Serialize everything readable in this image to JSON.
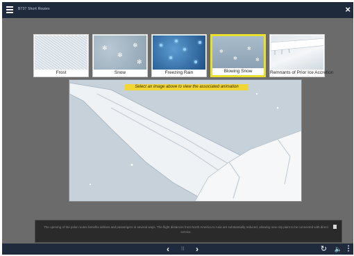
{
  "header": {
    "title": "B737 Short Routes",
    "menu_icon": "hamburger-menu-icon",
    "close_icon": "close-icon"
  },
  "thumbnails": [
    {
      "label": "Frost",
      "selected": false
    },
    {
      "label": "Snow",
      "selected": false
    },
    {
      "label": "Freezing Rain",
      "selected": false
    },
    {
      "label": "Blowing Snow",
      "selected": true
    },
    {
      "label": "Remnants of Prior Ice Accretion",
      "selected": false
    }
  ],
  "instruction": "Select an image above to view the associated animation",
  "caption": "The opening of the polar routes benefits airlines and passengers in several ways. The flight distances from North America to Asia are substantially reduced, allowing new city pairs to be connected with direct service.",
  "footer": {
    "prev_label": "‹",
    "pause_label": "II",
    "next_label": "›",
    "reload_icon": "reload-icon",
    "volume_icon": "volume-icon",
    "more_icon": "more-icon"
  },
  "colors": {
    "bar": "#1f2b3c",
    "selected_border": "#e8e02a",
    "instruction_bg": "#f1d635"
  }
}
